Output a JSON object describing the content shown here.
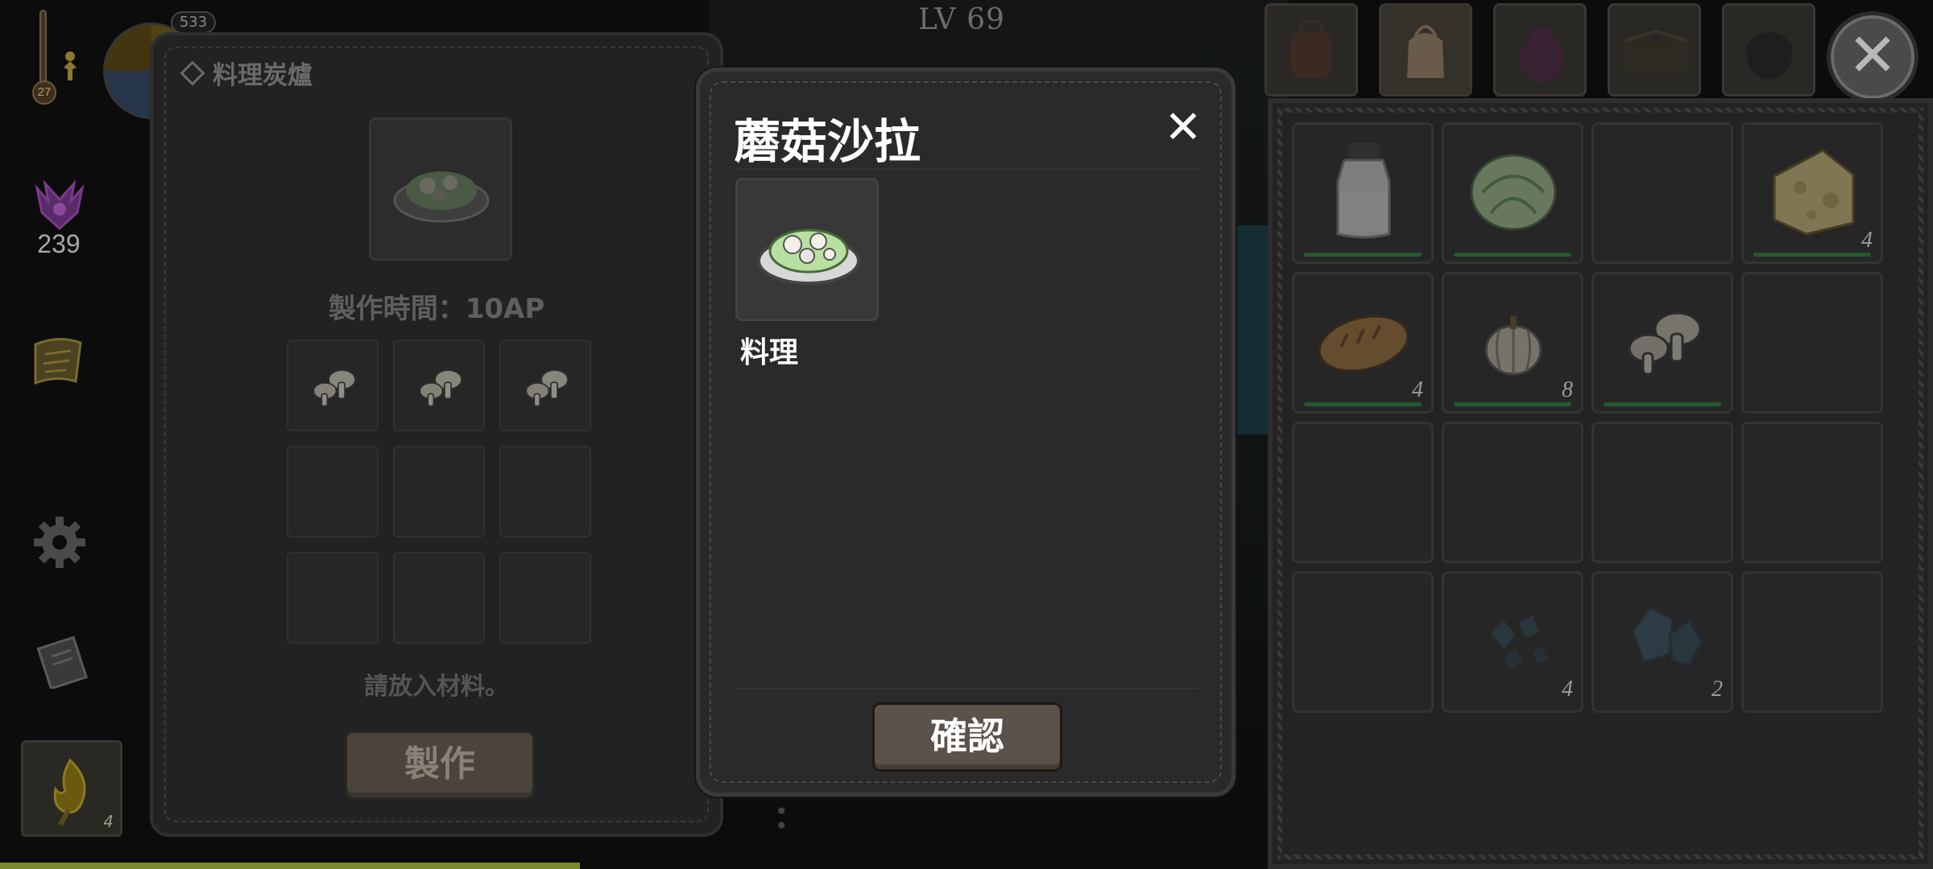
{
  "hud": {
    "temperature": "27",
    "purple_count": "239",
    "dial_badge": "533",
    "fire_count": "4",
    "icons": [
      "thermometer-icon",
      "person-icon",
      "day-dial-icon",
      "purple-sanity-icon",
      "map-scroll-icon",
      "gear-icon",
      "journal-icon",
      "fire-torch-icon"
    ]
  },
  "level": "LV 69",
  "stove": {
    "title": "料理炭爐",
    "time_label": "製作時間：10AP",
    "hint": "請放入材料。",
    "make_button": "製作",
    "ingredients": [
      "mushroom",
      "mushroom",
      "mushroom",
      "",
      "",
      "",
      "",
      "",
      ""
    ]
  },
  "modal": {
    "title": "蘑菇沙拉",
    "close": "✕",
    "category": "料理",
    "confirm": "確認"
  },
  "inventory": {
    "tabs": [
      "backpack-tab",
      "satchel-tab",
      "pouch-tab",
      "chest-tab",
      "bag-tab"
    ],
    "close": "✕",
    "slots": [
      {
        "item": "milk-bottle",
        "qty": "",
        "bar": true
      },
      {
        "item": "cabbage",
        "qty": "",
        "bar": true
      },
      {
        "item": "",
        "qty": "",
        "bar": false
      },
      {
        "item": "cheese",
        "qty": "4",
        "bar": true
      },
      {
        "item": "bread",
        "qty": "4",
        "bar": true
      },
      {
        "item": "pumpkin",
        "qty": "8",
        "bar": true
      },
      {
        "item": "mushroom",
        "qty": "",
        "bar": true
      },
      {
        "item": "",
        "qty": "",
        "bar": false
      },
      {
        "item": "",
        "qty": "",
        "bar": false
      },
      {
        "item": "",
        "qty": "",
        "bar": false
      },
      {
        "item": "",
        "qty": "",
        "bar": false
      },
      {
        "item": "",
        "qty": "",
        "bar": false
      },
      {
        "item": "",
        "qty": "",
        "bar": false
      },
      {
        "item": "crystal-shards",
        "qty": "4",
        "bar": false
      },
      {
        "item": "crystal",
        "qty": "2",
        "bar": false
      },
      {
        "item": "",
        "qty": "",
        "bar": false
      }
    ]
  },
  "colors": {
    "panel": "#2a2a2a",
    "button": "#5b524a",
    "freshness_bar": "#245a2e"
  }
}
